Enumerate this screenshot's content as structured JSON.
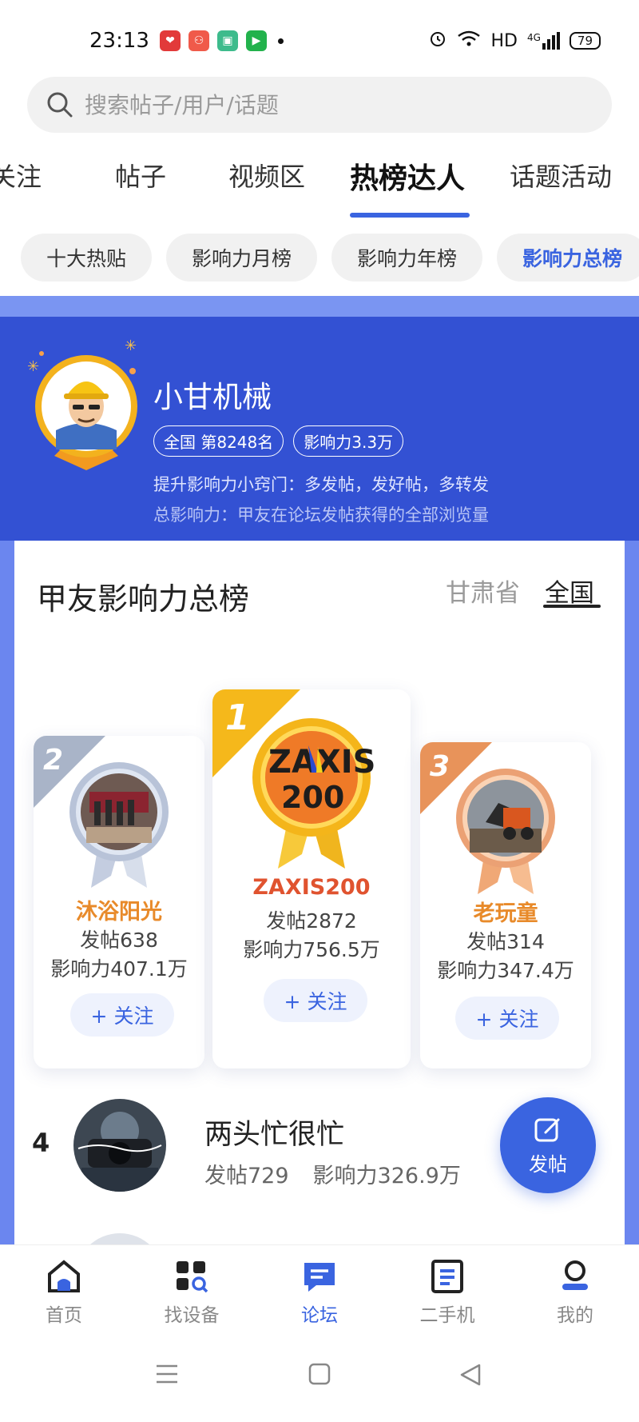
{
  "status_bar": {
    "time": "23:13",
    "network": "HD",
    "signal": "4G",
    "battery": "79",
    "app_icons": [
      "lottery-app-icon",
      "team-app-icon",
      "shopping-app-icon",
      "video-app-icon"
    ]
  },
  "search": {
    "placeholder": "搜索帖子/用户/话题"
  },
  "tabs": [
    {
      "label": "关注"
    },
    {
      "label": "帖子"
    },
    {
      "label": "视频区"
    },
    {
      "label": "热榜达人"
    },
    {
      "label": "话题活动"
    }
  ],
  "active_tab": "热榜达人",
  "chips": [
    {
      "label": "十大热贴"
    },
    {
      "label": "影响力月榜"
    },
    {
      "label": "影响力年榜"
    },
    {
      "label": "影响力总榜"
    }
  ],
  "active_chip": "影响力总榜",
  "me": {
    "name": "小甘机械",
    "rank_badge": "全国  第8248名",
    "influence_badge": "影响力3.3万",
    "tip1": "提升影响力小窍门：多发帖，发好帖，多转发",
    "tip2": "总影响力：甲友在论坛发帖获得的全部浏览量"
  },
  "board": {
    "title": "甲友影响力总榜",
    "scope_province": "甘肃省",
    "scope_country": "全国"
  },
  "podium": [
    {
      "rank": "1",
      "name": "ZAXIS200",
      "posts": "发帖2872",
      "influence": "影响力756.5万",
      "follow": "+ 关注",
      "name_color": "#e0532f"
    },
    {
      "rank": "2",
      "name": "沐浴阳光",
      "posts": "发帖638",
      "influence": "影响力407.1万",
      "follow": "+ 关注",
      "name_color": "#e88a2a"
    },
    {
      "rank": "3",
      "name": "老玩童",
      "posts": "发帖314",
      "influence": "影响力347.4万",
      "follow": "+ 关注",
      "name_color": "#e88a2a"
    }
  ],
  "list": [
    {
      "rank": "4",
      "name": "两头忙很忙",
      "posts": "发帖729",
      "influence": "影响力326.9万"
    }
  ],
  "fab": {
    "label": "发帖"
  },
  "bottom_nav": [
    {
      "label": "首页"
    },
    {
      "label": "找设备"
    },
    {
      "label": "论坛"
    },
    {
      "label": "二手机"
    },
    {
      "label": "我的"
    }
  ],
  "active_nav": "论坛",
  "colors": {
    "accent": "#3a64e0",
    "band": "#3351d3",
    "gold": "#f5b81b",
    "silver": "#a9b4c8",
    "bronze": "#e8935a"
  }
}
